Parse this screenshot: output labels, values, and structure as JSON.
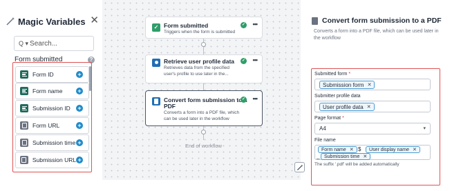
{
  "magic_variables": {
    "title": "Magic Variables",
    "close_icon": "close-icon",
    "search": {
      "placeholder": "Search...",
      "type_selector": "Q ▾"
    },
    "section_title": "Form submitted",
    "items": [
      {
        "label": "Form ID",
        "icon": "text-field-icon",
        "color": "#1f6b5c"
      },
      {
        "label": "Form name",
        "icon": "text-field-icon",
        "color": "#1f6b5c"
      },
      {
        "label": "Submission ID",
        "icon": "text-field-icon",
        "color": "#1f6b5c"
      },
      {
        "label": "Form URL",
        "icon": "url-icon",
        "color": "#6b7280"
      },
      {
        "label": "Submission time",
        "icon": "date-icon",
        "color": "#6b7280"
      },
      {
        "label": "Submission URL",
        "icon": "url-icon",
        "color": "#6b7280"
      }
    ]
  },
  "workflow": {
    "nodes": [
      {
        "title": "Form submitted",
        "description": "Triggers when the form is submitted",
        "icon": "check-square-icon",
        "status": "complete"
      },
      {
        "title": "Retrieve user profile data",
        "description_lines": [
          "Retrieves data from the specified",
          "user's profile to use later in the..."
        ],
        "icon": "user-icon",
        "status": "complete"
      },
      {
        "title_lines": [
          "Convert form submission to a",
          "PDF"
        ],
        "description_lines": [
          "Converts a form into a PDF file, which",
          "can be used later in the workflow"
        ],
        "icon": "document-icon",
        "status": "complete",
        "selected": true
      }
    ],
    "end_label": "End of workflow"
  },
  "details": {
    "title": "Convert form submission to a PDF",
    "description": "Converts a form into a PDF file, which can be used later in the workflow",
    "fields": {
      "submitted_form": {
        "label": "Submitted form",
        "required": "*",
        "chips": [
          "Submission form"
        ]
      },
      "submitter_profile": {
        "label": "Submitter profile data",
        "chips": [
          "User profile data"
        ]
      },
      "page_format": {
        "label": "Page format",
        "required": "*",
        "value": "A4"
      },
      "file_name": {
        "label": "File name",
        "chips": [
          "Form name",
          "User display name",
          "Submission time"
        ],
        "separator_1": "$",
        "separator_2": "_"
      }
    },
    "hint": "The suffix '.pdf' will be added automatically"
  },
  "colors": {
    "highlight_border": "#e05252",
    "chip_border": "#4b9bd1",
    "status_green": "#2f9e6a",
    "accent_blue": "#1f8ac9"
  }
}
